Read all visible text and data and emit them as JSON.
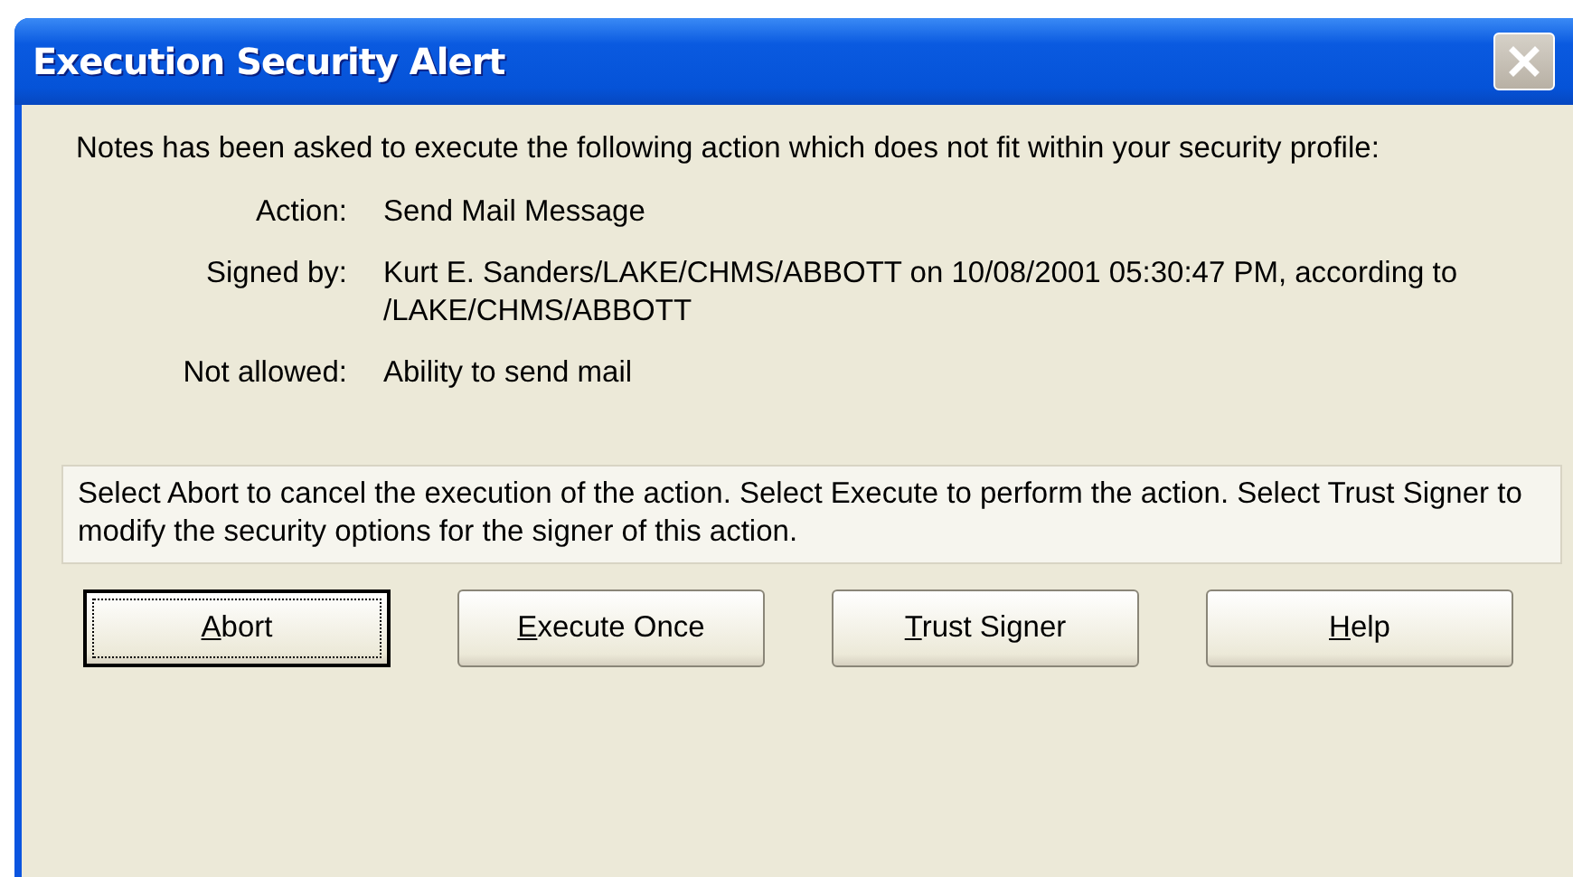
{
  "window": {
    "title": "Execution Security Alert"
  },
  "message": "Notes has been asked to execute the following action which does not fit within your security profile:",
  "details": [
    {
      "label": "Action:",
      "value": "Send Mail Message"
    },
    {
      "label": "Signed by:",
      "value": "Kurt E. Sanders/LAKE/CHMS/ABBOTT on 10/08/2001 05:30:47 PM, according to /LAKE/CHMS/ABBOTT"
    },
    {
      "label": "Not allowed:",
      "value": "Ability to send mail"
    }
  ],
  "instructions": "Select Abort to cancel the execution of the action.  Select Execute to perform the action.  Select Trust Signer to modify the security options for the signer of this action.",
  "buttons": [
    {
      "mnemonic": "A",
      "rest": "bort",
      "default": true
    },
    {
      "mnemonic": "E",
      "rest": "xecute Once",
      "default": false
    },
    {
      "mnemonic": "T",
      "rest": "rust Signer",
      "default": false
    },
    {
      "mnemonic": "H",
      "rest": "elp",
      "default": false
    }
  ]
}
